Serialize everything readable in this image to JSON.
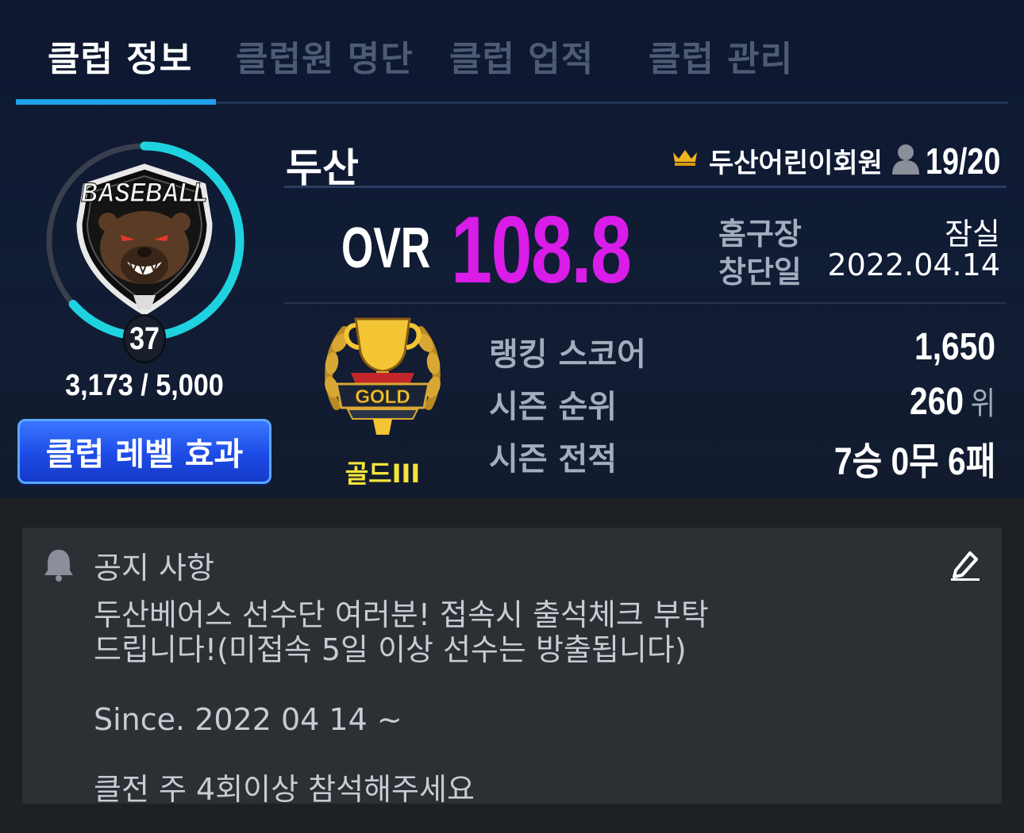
{
  "tabs": [
    {
      "label": "클럽 정보",
      "active": true
    },
    {
      "label": "클럽원 명단",
      "active": false
    },
    {
      "label": "클럽 업적",
      "active": false
    },
    {
      "label": "클럽 관리",
      "active": false
    }
  ],
  "emblem": {
    "logo_text": "BASEBALL",
    "level": "37",
    "exp": "3,173 / 5,000",
    "exp_progress": 0.6346,
    "ring_color": "#1fd2e0"
  },
  "level_effect_button": "클럽 레벨 효과",
  "club": {
    "name": "두산",
    "leader_icon": "crown-icon",
    "leader": "두산어린이회원",
    "member_icon": "person-icon",
    "members": "19/20"
  },
  "ovr": {
    "label": "OVR",
    "value": "108.8",
    "color": "#d91ce8"
  },
  "info": {
    "stadium_label": "홈구장",
    "stadium_value": "잠실",
    "founded_label": "창단일",
    "founded_value": "2022.04.14"
  },
  "rank": {
    "tier_badge_text": "GOLD",
    "tier": "골드III",
    "tier_color": "#f4e43a",
    "score_label": "랭킹 스코어",
    "score_value": "1,650",
    "season_rank_label": "시즌 순위",
    "season_rank_value": "260",
    "season_rank_unit": "위",
    "season_record_label": "시즌 전적",
    "season_record_value": "7승 0무 6패"
  },
  "notice": {
    "icon": "bell-icon",
    "title": "공지 사항",
    "edit_icon": "pencil-icon",
    "body": "두산베어스 선수단 여러분! 접속시 출석체크 부탁\n드립니다!(미접속 5일 이상 선수는 방출됩니다)\n\nSince. 2022 04 14 ~\n\n클전 주 4회이상 참석해주세요"
  }
}
